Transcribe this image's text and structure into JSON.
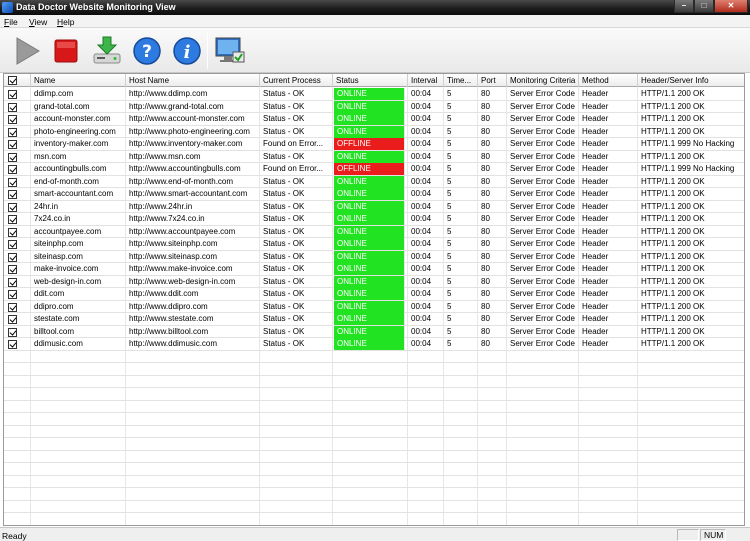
{
  "window": {
    "title": "Data Doctor Website Monitoring View"
  },
  "menu": [
    {
      "label": "File"
    },
    {
      "label": "View"
    },
    {
      "label": "Help"
    }
  ],
  "toolbar": [
    {
      "icon": "play-icon"
    },
    {
      "icon": "stop-icon"
    },
    {
      "icon": "save-icon"
    },
    {
      "icon": "help-icon"
    },
    {
      "icon": "info-icon"
    },
    {
      "icon": "monitor-view-icon"
    }
  ],
  "columns": [
    {
      "label": ""
    },
    {
      "label": "Name"
    },
    {
      "label": "Host Name"
    },
    {
      "label": "Current Process"
    },
    {
      "label": "Status"
    },
    {
      "label": "Interval"
    },
    {
      "label": "Time..."
    },
    {
      "label": "Port"
    },
    {
      "label": "Monitoring Criteria"
    },
    {
      "label": "Method"
    },
    {
      "label": "Header/Server Info"
    }
  ],
  "rows": [
    [
      "ddimp.com",
      "http://www.ddimp.com",
      "Status - OK",
      "ONLINE",
      "00:04",
      "5",
      "80",
      "Server Error Code",
      "Header",
      "HTTP/1.1 200 OK"
    ],
    [
      "grand-total.com",
      "http://www.grand-total.com",
      "Status - OK",
      "ONLINE",
      "00:04",
      "5",
      "80",
      "Server Error Code",
      "Header",
      "HTTP/1.1 200 OK"
    ],
    [
      "account-monster.com",
      "http://www.account-monster.com",
      "Status - OK",
      "ONLINE",
      "00:04",
      "5",
      "80",
      "Server Error Code",
      "Header",
      "HTTP/1.1 200 OK"
    ],
    [
      "photo-engineering.com",
      "http://www.photo-engineering.com",
      "Status - OK",
      "ONLINE",
      "00:04",
      "5",
      "80",
      "Server Error Code",
      "Header",
      "HTTP/1.1 200 OK"
    ],
    [
      "inventory-maker.com",
      "http://www.inventory-maker.com",
      "Found on Error...",
      "OFFLINE",
      "00:04",
      "5",
      "80",
      "Server Error Code",
      "Header",
      "HTTP/1.1 999 No Hacking"
    ],
    [
      "msn.com",
      "http://www.msn.com",
      "Status - OK",
      "ONLINE",
      "00:04",
      "5",
      "80",
      "Server Error Code",
      "Header",
      "HTTP/1.1 200 OK"
    ],
    [
      "accountingbulls.com",
      "http://www.accountingbulls.com",
      "Found on Error...",
      "OFFLINE",
      "00:04",
      "5",
      "80",
      "Server Error Code",
      "Header",
      "HTTP/1.1 999 No Hacking"
    ],
    [
      "end-of-month.com",
      "http://www.end-of-month.com",
      "Status - OK",
      "ONLINE",
      "00:04",
      "5",
      "80",
      "Server Error Code",
      "Header",
      "HTTP/1.1 200 OK"
    ],
    [
      "smart-accountant.com",
      "http://www.smart-accountant.com",
      "Status - OK",
      "ONLINE",
      "00:04",
      "5",
      "80",
      "Server Error Code",
      "Header",
      "HTTP/1.1 200 OK"
    ],
    [
      "24hr.in",
      "http://www.24hr.in",
      "Status - OK",
      "ONLINE",
      "00:04",
      "5",
      "80",
      "Server Error Code",
      "Header",
      "HTTP/1.1 200 OK"
    ],
    [
      "7x24.co.in",
      "http://www.7x24.co.in",
      "Status - OK",
      "ONLINE",
      "00:04",
      "5",
      "80",
      "Server Error Code",
      "Header",
      "HTTP/1.1 200 OK"
    ],
    [
      "accountpayee.com",
      "http://www.accountpayee.com",
      "Status - OK",
      "ONLINE",
      "00:04",
      "5",
      "80",
      "Server Error Code",
      "Header",
      "HTTP/1.1 200 OK"
    ],
    [
      "siteinphp.com",
      "http://www.siteinphp.com",
      "Status - OK",
      "ONLINE",
      "00:04",
      "5",
      "80",
      "Server Error Code",
      "Header",
      "HTTP/1.1 200 OK"
    ],
    [
      "siteinasp.com",
      "http://www.siteinasp.com",
      "Status - OK",
      "ONLINE",
      "00:04",
      "5",
      "80",
      "Server Error Code",
      "Header",
      "HTTP/1.1 200 OK"
    ],
    [
      "make-invoice.com",
      "http://www.make-invoice.com",
      "Status - OK",
      "ONLINE",
      "00:04",
      "5",
      "80",
      "Server Error Code",
      "Header",
      "HTTP/1.1 200 OK"
    ],
    [
      "web-design-in.com",
      "http://www.web-design-in.com",
      "Status - OK",
      "ONLINE",
      "00:04",
      "5",
      "80",
      "Server Error Code",
      "Header",
      "HTTP/1.1 200 OK"
    ],
    [
      "ddit.com",
      "http://www.ddit.com",
      "Status - OK",
      "ONLINE",
      "00:04",
      "5",
      "80",
      "Server Error Code",
      "Header",
      "HTTP/1.1 200 OK"
    ],
    [
      "ddipro.com",
      "http://www.ddipro.com",
      "Status - OK",
      "ONLINE",
      "00:04",
      "5",
      "80",
      "Server Error Code",
      "Header",
      "HTTP/1.1 200 OK"
    ],
    [
      "stestate.com",
      "http://www.stestate.com",
      "Status - OK",
      "ONLINE",
      "00:04",
      "5",
      "80",
      "Server Error Code",
      "Header",
      "HTTP/1.1 200 OK"
    ],
    [
      "billtool.com",
      "http://www.billtool.com",
      "Status - OK",
      "ONLINE",
      "00:04",
      "5",
      "80",
      "Server Error Code",
      "Header",
      "HTTP/1.1 200 OK"
    ],
    [
      "ddimusic.com",
      "http://www.ddimusic.com",
      "Status - OK",
      "ONLINE",
      "00:04",
      "5",
      "80",
      "Server Error Code",
      "Header",
      "HTTP/1.1 200 OK"
    ]
  ],
  "status": {
    "text": "Ready",
    "num": "NUM"
  },
  "colors": {
    "online": "#22e322",
    "offline": "#ea1c1c"
  }
}
